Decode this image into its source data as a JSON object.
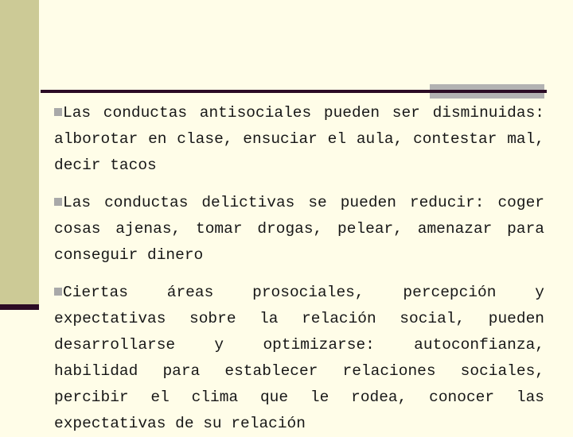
{
  "slide": {
    "background_color": "#fffde8",
    "text_color": "#171717",
    "accent_color": "#2b0b24",
    "band_color": "#ccca96",
    "rule_block_color": "#b2b2b2",
    "bullet_color": "#a9a9a9",
    "bullet_glyph": "filled-square",
    "paragraphs": [
      {
        "id": "bullet-1",
        "text": "Las conductas antisociales pueden ser disminuidas: alborotar en clase, ensuciar el aula, contestar mal, decir tacos"
      },
      {
        "id": "bullet-2",
        "text": "Las conductas delictivas se pueden reducir: coger cosas ajenas, tomar drogas, pelear, amenazar para conseguir dinero"
      },
      {
        "id": "bullet-3",
        "text": "Ciertas áreas prosociales, percepción y expectativas sobre la relación social, pueden desarrollarse y optimizarse: autoconfianza, habilidad para establecer relaciones sociales, percibir el clima que le rodea, conocer las expectativas de su relación"
      }
    ]
  }
}
